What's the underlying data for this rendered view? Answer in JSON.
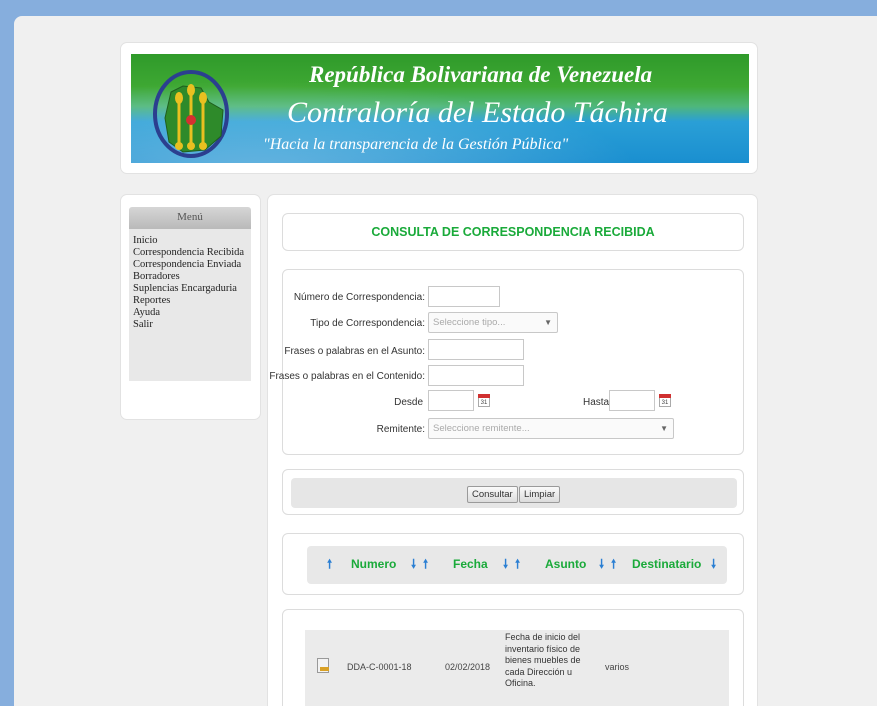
{
  "header": {
    "line1": "República Bolivariana de Venezuela",
    "line2": "Contraloría del Estado Táchira",
    "line3": "\"Hacia la transparencia de la Gestión Pública\""
  },
  "menu": {
    "title": "Menú",
    "items": [
      {
        "label": "Inicio"
      },
      {
        "label": "Correspondencia Recibida"
      },
      {
        "label": "Correspondencia Enviada"
      },
      {
        "label": "Borradores"
      },
      {
        "label": "Suplencias Encargaduria"
      },
      {
        "label": "Reportes"
      },
      {
        "label": "Ayuda"
      },
      {
        "label": "Salir"
      }
    ]
  },
  "main": {
    "title": "CONSULTA DE CORRESPONDENCIA RECIBIDA",
    "form": {
      "numero_label": "Número de Correspondencia:",
      "tipo_label": "Tipo de Correspondencia:",
      "tipo_placeholder": "Seleccione tipo...",
      "asunto_label": "Frases o palabras en el Asunto:",
      "contenido_label": "Frases o palabras en el Contenido:",
      "desde_label": "Desde",
      "hasta_label": "Hasta",
      "calendar_day": "31",
      "remitente_label": "Remitente:",
      "remitente_placeholder": "Seleccione remitente..."
    },
    "buttons": {
      "consultar": "Consultar",
      "limpiar": "Limpiar"
    },
    "sort": {
      "numero": "Numero",
      "fecha": "Fecha",
      "asunto": "Asunto",
      "destinatario": "Destinatario"
    },
    "results": [
      {
        "numero": "DDA-C-0001-18",
        "fecha": "02/02/2018",
        "asunto": "Fecha de inicio del inventario físico de bienes muebles de cada Dirección u Oficina.",
        "destinatario": "varios"
      }
    ]
  },
  "icons": {
    "calendar": "calendar-icon",
    "sort_up": "arrow-up-icon",
    "sort_down": "arrow-down-icon",
    "document": "document-icon"
  },
  "colors": {
    "accent_green": "#1aaa3a",
    "arrow_blue": "#2b7fd3",
    "page_background": "#86aedd"
  }
}
